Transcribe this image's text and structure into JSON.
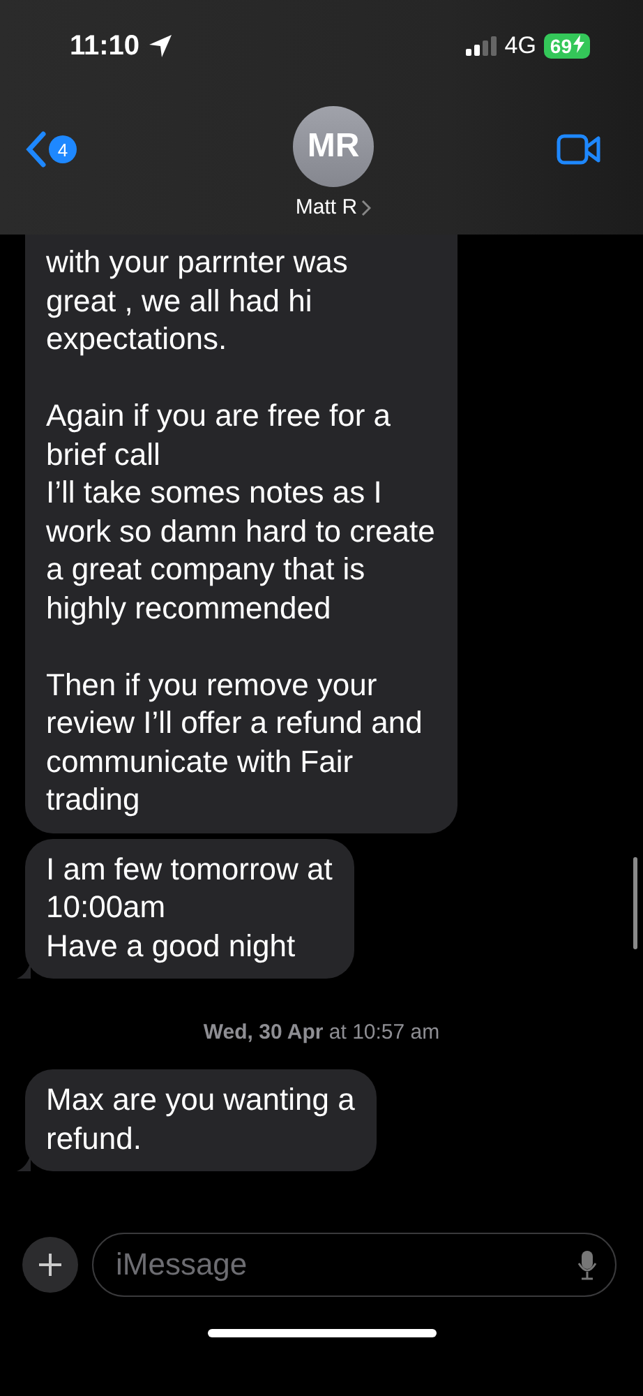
{
  "status_bar": {
    "time": "11:10",
    "network": "4G",
    "battery": "69",
    "charging": true
  },
  "header": {
    "back_badge": "4",
    "avatar_initials": "MR",
    "contact_name": "Matt R"
  },
  "messages": [
    {
      "kind": "bubble",
      "text": "with your parrnter was\ngreat , we all had hi\nexpectations.\n\nAgain if you are free for a\nbrief call\nI’ll take somes notes as I\nwork so damn hard to create\na great company that is\nhighly recommended\n\nThen if you remove your\nreview I’ll offer a refund and\ncommunicate with Fair\ntrading",
      "tail": false
    },
    {
      "kind": "bubble",
      "text": "I am few tomorrow at\n10:00am\nHave a good night",
      "tail": true
    },
    {
      "kind": "timestamp",
      "text": "**Wed, 30 Apr** at 10:57 am"
    },
    {
      "kind": "bubble",
      "text": "Max are you wanting a\nrefund.",
      "tail": true
    }
  ],
  "composer": {
    "placeholder": "iMessage"
  }
}
